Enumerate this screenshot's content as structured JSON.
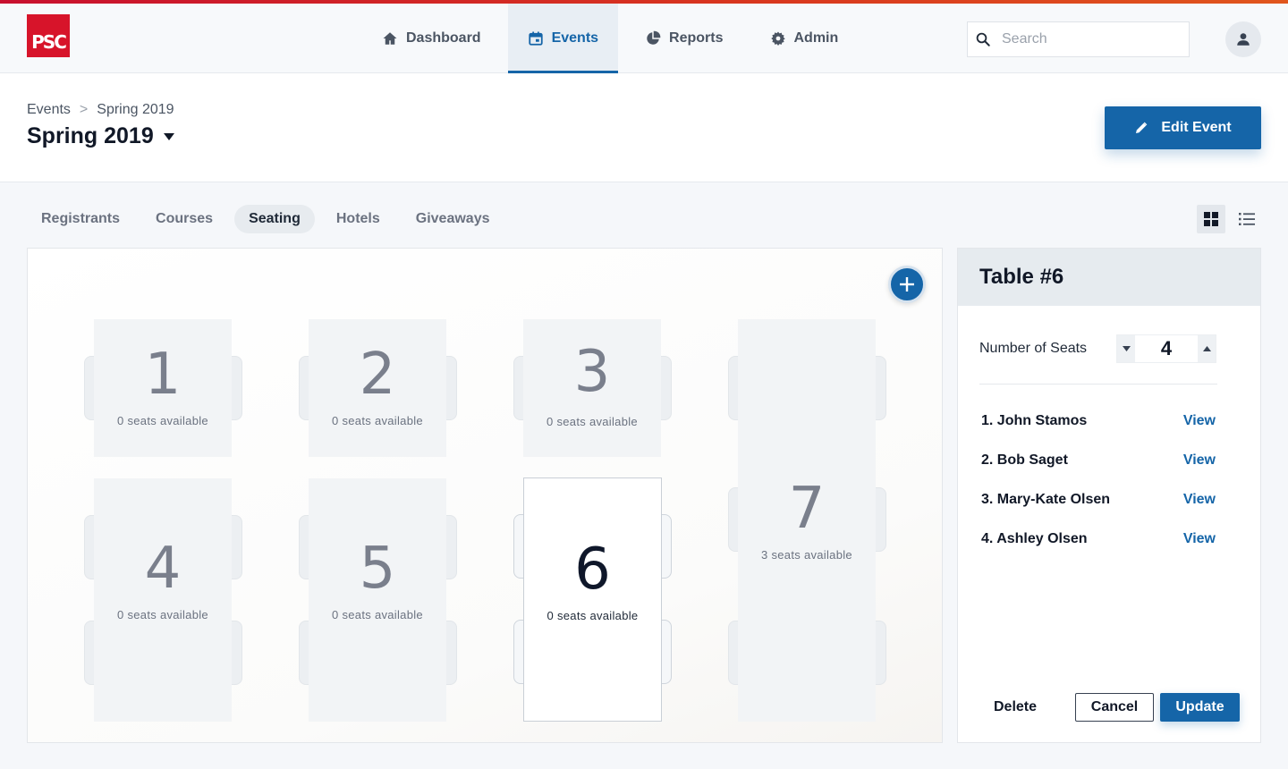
{
  "app": {
    "logo_text": "PSC",
    "brand_color": "#d7142a",
    "accent_color": "#1565a8"
  },
  "nav": [
    {
      "label": "Dashboard",
      "icon": "home-icon",
      "active": false
    },
    {
      "label": "Events",
      "icon": "calendar-icon",
      "active": true
    },
    {
      "label": "Reports",
      "icon": "pie-chart-icon",
      "active": false
    },
    {
      "label": "Admin",
      "icon": "gear-icon",
      "active": false
    }
  ],
  "search": {
    "placeholder": "Search",
    "value": ""
  },
  "breadcrumb": {
    "root": "Events",
    "separator": ">",
    "current": "Spring 2019"
  },
  "page": {
    "title": "Spring 2019",
    "edit_label": "Edit Event"
  },
  "tabs": [
    {
      "label": "Registrants",
      "active": false
    },
    {
      "label": "Courses",
      "active": false
    },
    {
      "label": "Seating",
      "active": true
    },
    {
      "label": "Hotels",
      "active": false
    },
    {
      "label": "Giveaways",
      "active": false
    }
  ],
  "view_modes": {
    "active": "grid"
  },
  "tables": [
    {
      "number": "1",
      "availability": "0 seats available"
    },
    {
      "number": "2",
      "availability": "0 seats available"
    },
    {
      "number": "3",
      "availability": "0 seats available"
    },
    {
      "number": "4",
      "availability": "0 seats available"
    },
    {
      "number": "5",
      "availability": "0 seats available"
    },
    {
      "number": "6",
      "availability": "0 seats available",
      "selected": true
    },
    {
      "number": "7",
      "availability": "3 seats available"
    }
  ],
  "panel": {
    "title": "Table #6",
    "seats_label": "Number of Seats",
    "seats_value": "4",
    "attendees": [
      {
        "name": "1. John Stamos",
        "action": "View"
      },
      {
        "name": "2. Bob Saget",
        "action": "View"
      },
      {
        "name": "3. Mary-Kate Olsen",
        "action": "View"
      },
      {
        "name": "4. Ashley Olsen",
        "action": "View"
      }
    ],
    "delete_label": "Delete",
    "cancel_label": "Cancel",
    "update_label": "Update"
  }
}
